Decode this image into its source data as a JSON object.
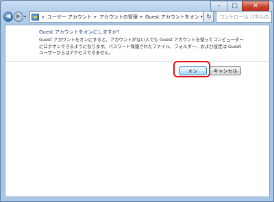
{
  "window": {
    "close_glyph": "✕",
    "max_glyph": "□",
    "min_glyph": "–"
  },
  "nav": {
    "back_glyph": "◀",
    "forward_glyph": "▶",
    "dropdown_glyph": "▾",
    "breadcrumb": {
      "overflow": "«",
      "items": [
        "ユーザー アカウント",
        "アカウントの管理",
        "Guest アカウントをオン"
      ],
      "separator": "▸"
    },
    "refresh_glyph": "↻",
    "search_placeholder": "コントロール パネルの..."
  },
  "content": {
    "heading": "Guest アカウントをオンにしますか?",
    "description": "Guest アカウントをオンにすると、アカウントがない人でも Guest アカウントを使ってコンピューターにログオンできるようになります。パスワード保護されたファイル、フォルダー、および設定は Guest ユーザーからはアクセスできません。",
    "buttons": {
      "on": "オン",
      "cancel": "キャンセル"
    }
  },
  "colors": {
    "highlight": "#e00d0d",
    "heading": "#1f3e7a"
  }
}
